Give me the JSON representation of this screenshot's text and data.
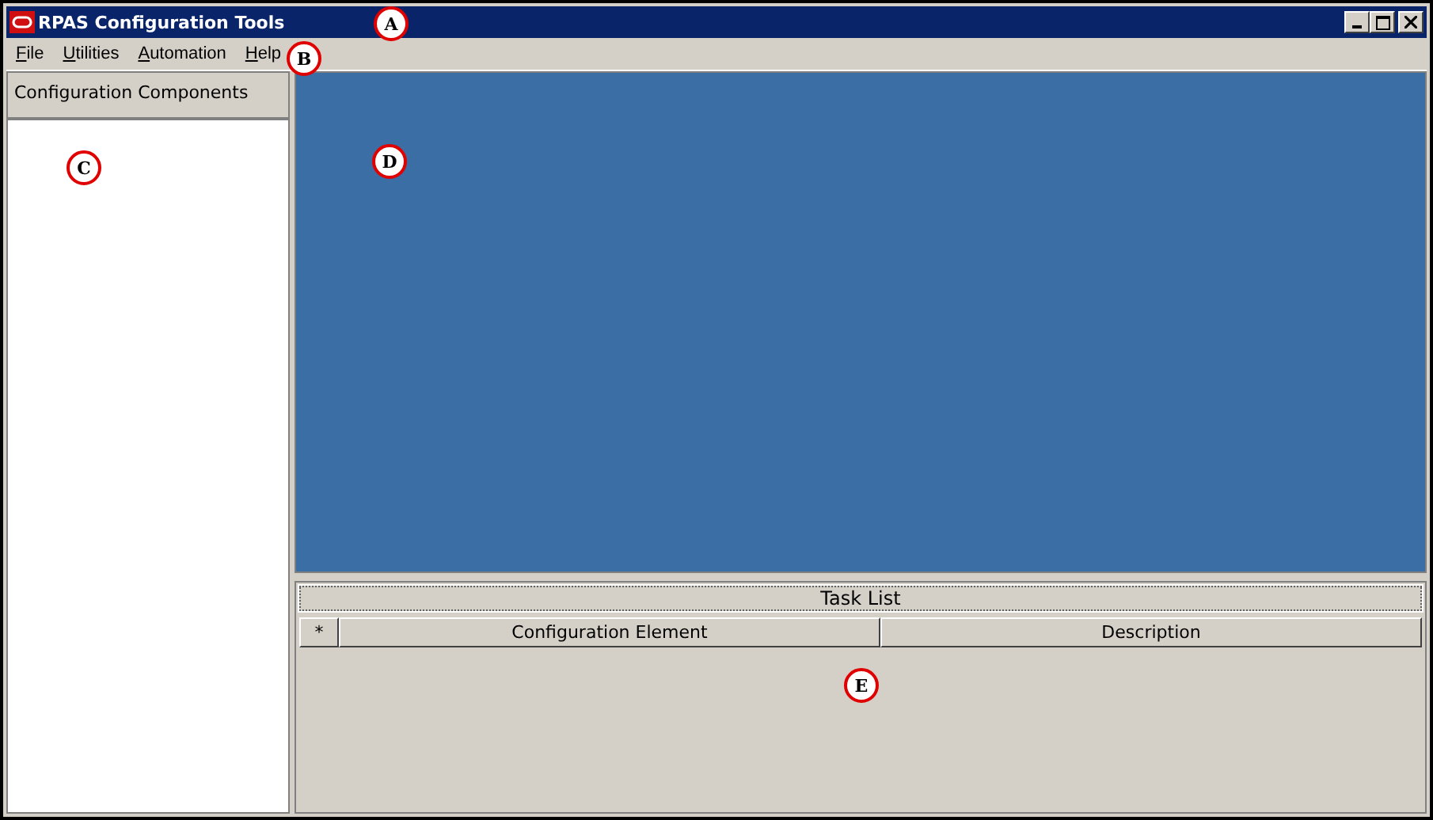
{
  "window": {
    "title": "RPAS Configuration Tools"
  },
  "menu": [
    "File",
    "Utilities",
    "Automation",
    "Help"
  ],
  "sidebar": {
    "title": "Configuration Components"
  },
  "task_list": {
    "title": "Task List",
    "columns": [
      "*",
      "Configuration Element",
      "Description"
    ]
  },
  "callouts": [
    {
      "label": "A"
    },
    {
      "label": "B"
    },
    {
      "label": "C"
    },
    {
      "label": "D"
    },
    {
      "label": "E"
    }
  ]
}
